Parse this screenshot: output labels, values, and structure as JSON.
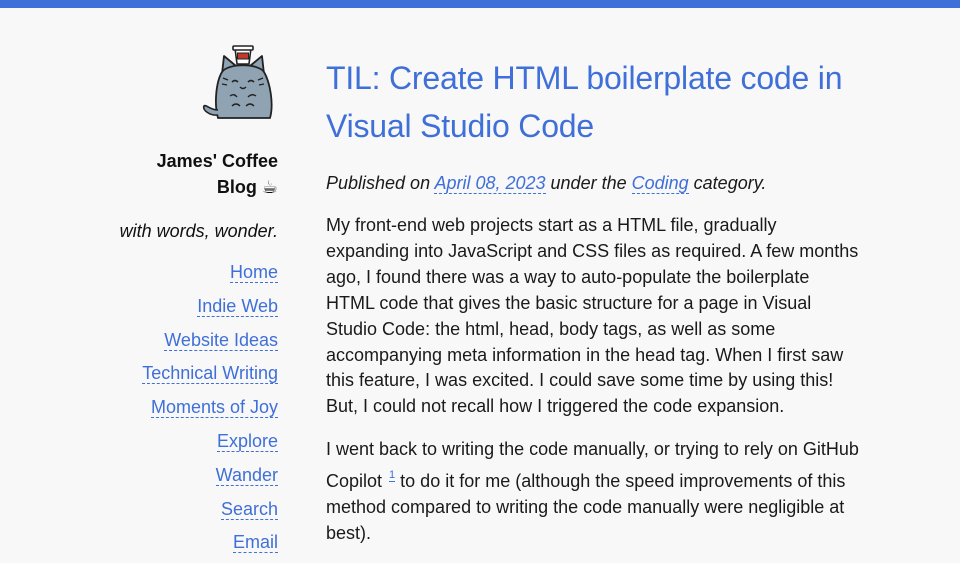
{
  "colors": {
    "accent": "#3f6fd8",
    "background": "#f8f8f8",
    "text": "#1a1a1a"
  },
  "sidebar": {
    "logo_icon": "coffee-cat-icon",
    "site_title_line1": "James' Coffee",
    "site_title_line2": "Blog ☕",
    "tagline": "with words, wonder.",
    "nav": [
      {
        "label": "Home"
      },
      {
        "label": "Indie Web"
      },
      {
        "label": "Website Ideas"
      },
      {
        "label": "Technical Writing"
      },
      {
        "label": "Moments of Joy"
      },
      {
        "label": "Explore"
      },
      {
        "label": "Wander"
      },
      {
        "label": "Search"
      },
      {
        "label": "Email"
      }
    ]
  },
  "post": {
    "title": "TIL: Create HTML boilerplate code in Visual Studio Code",
    "meta": {
      "published_prefix": "Published on",
      "date": "April 08, 2023",
      "under": "under the",
      "category": "Coding",
      "suffix": "category."
    },
    "paragraph1": "My front-end web projects start as a HTML file, gradually expanding into JavaScript and CSS files as required. A few months ago, I found there was a way to auto-populate the boilerplate HTML code that gives the basic structure for a page in Visual Studio Code: the html, head, body tags, as well as some accompanying meta information in the head tag. When I first saw this feature, I was excited. I could save some time by using this! But, I could not recall how I triggered the code expansion.",
    "paragraph2_before": "I went back to writing the code manually, or trying to rely on GitHub Copilot",
    "footnote": "1",
    "paragraph2_after": " to do it for me (although the speed improvements of this method compared to writing the code manually were negligible at best)."
  }
}
